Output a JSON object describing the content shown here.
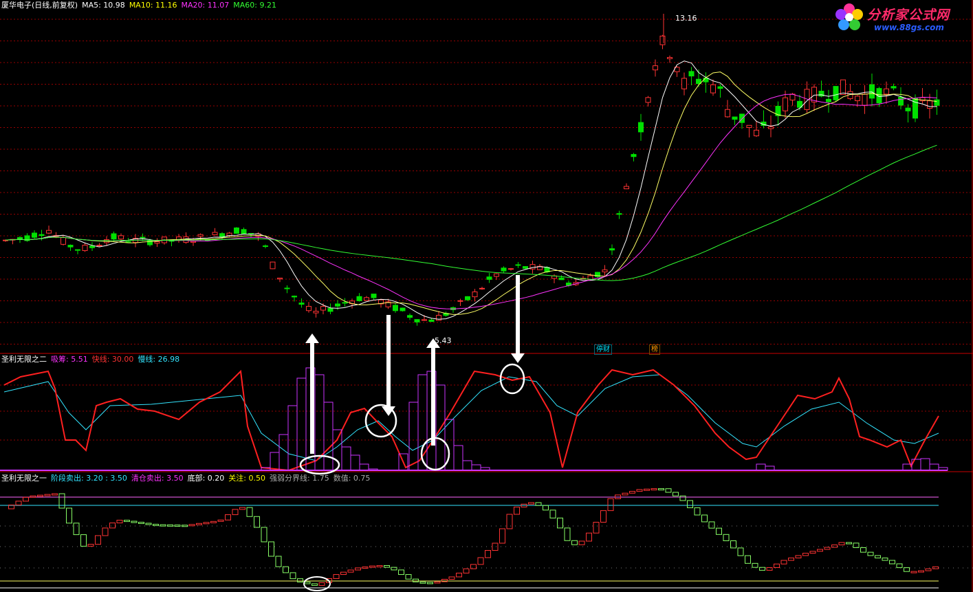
{
  "window": {
    "stock_name": "厦华电子(日线,前复权)",
    "ma_labels": [
      {
        "label": "MA5:",
        "value": "10.98",
        "color": "#ffffff"
      },
      {
        "label": "MA10:",
        "value": "11.16",
        "color": "#ffff00"
      },
      {
        "label": "MA20:",
        "value": "11.07",
        "color": "#ff33ff"
      },
      {
        "label": "MA60:",
        "value": "9.21",
        "color": "#33ff33"
      }
    ]
  },
  "logo": {
    "text": "分析家公式网",
    "url": "www.88gs.com"
  },
  "main_panel": {
    "high_label": "13.16",
    "low_label": "5.43",
    "badges": [
      {
        "text": "停财",
        "color": "#00e5ff"
      },
      {
        "text": "榜",
        "color": "#ff9a00"
      }
    ]
  },
  "panel2": {
    "title": "圣利无限之二",
    "indicators": [
      {
        "label": "吸筹:",
        "value": "5.51",
        "color": "#ff33ff"
      },
      {
        "label": "快线:",
        "value": "30.00",
        "color": "#ff3333"
      },
      {
        "label": "慢线:",
        "value": "26.98",
        "color": "#33e5ff"
      }
    ]
  },
  "panel3": {
    "title": "圣利无限之一",
    "indicators": [
      {
        "label": "阶段卖出:",
        "value": "3.20 : 3.50",
        "color": "#33e5ff"
      },
      {
        "label": "清仓卖出:",
        "value": "3.50",
        "color": "#ff33ff"
      },
      {
        "label": "底部:",
        "value": "0.20",
        "color": "#ffffff"
      },
      {
        "label": "关注:",
        "value": "0.50",
        "color": "#ffff00"
      },
      {
        "label": "强弱分界线:",
        "value": "1.75",
        "color": "#aaaaaa"
      },
      {
        "label": "数值:",
        "value": "0.75",
        "color": "#aaaaaa"
      }
    ]
  },
  "colors": {
    "up": "#ff3333",
    "down": "#00e000",
    "ma5": "#ffffff",
    "ma10": "#ffff66",
    "ma20": "#ff33ff",
    "ma60": "#33ff33",
    "grid": "#990000",
    "fast": "#ff2020",
    "slow": "#33e5ff",
    "accum": "#cc33ff"
  }
}
